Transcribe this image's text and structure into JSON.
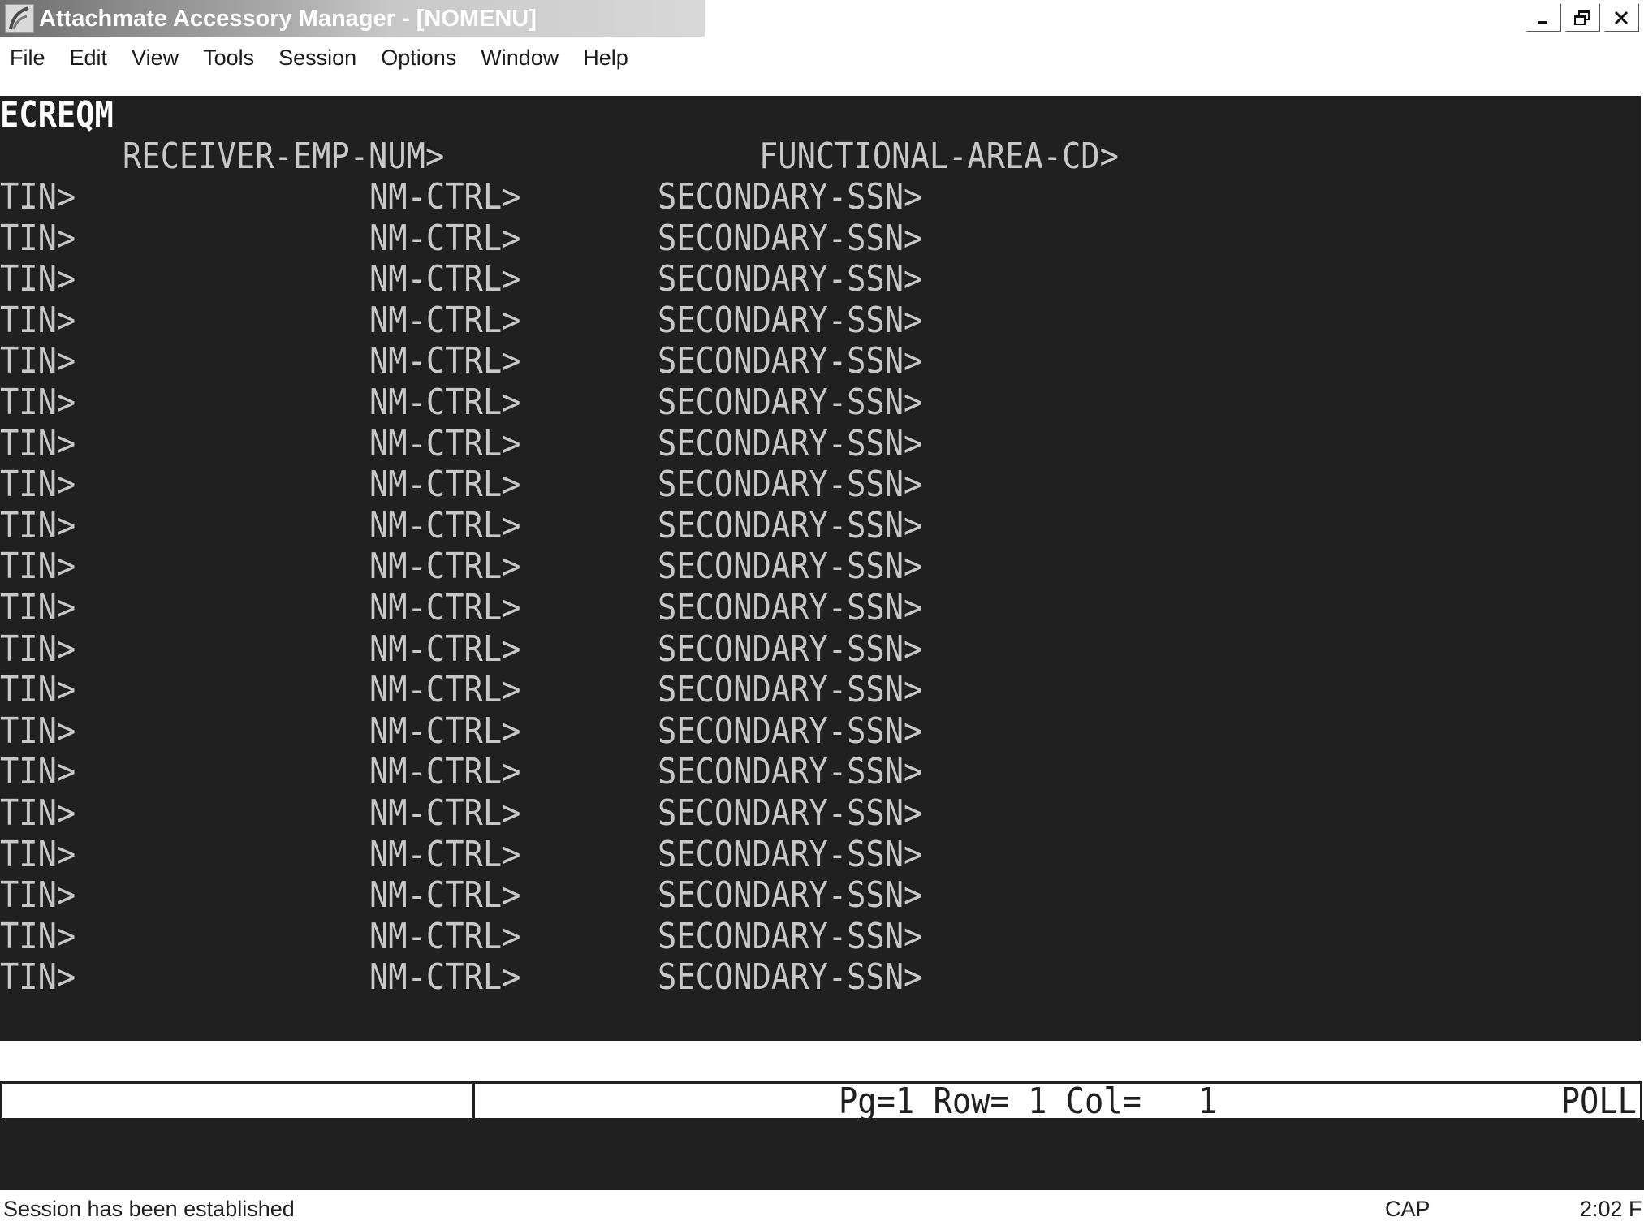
{
  "window": {
    "title": "Attachmate Accessory Manager - [NOMENU]",
    "icon": "attachmate-app-icon",
    "controls": [
      "minimize-icon",
      "restore-icon",
      "close-icon"
    ]
  },
  "menu": {
    "items": [
      "File",
      "Edit",
      "View",
      "Tools",
      "Session",
      "Options",
      "Window",
      "Help"
    ]
  },
  "terminal": {
    "screen_id": "ECREQM",
    "header": {
      "receiver_label": "RECEIVER-EMP-NUM>",
      "functional_label": "FUNCTIONAL-AREA-CD>"
    },
    "rows": [
      {
        "tin": "TIN>",
        "nm": "NM-CTRL>",
        "ssn": "SECONDARY-SSN>"
      },
      {
        "tin": "TIN>",
        "nm": "NM-CTRL>",
        "ssn": "SECONDARY-SSN>"
      },
      {
        "tin": "TIN>",
        "nm": "NM-CTRL>",
        "ssn": "SECONDARY-SSN>"
      },
      {
        "tin": "TIN>",
        "nm": "NM-CTRL>",
        "ssn": "SECONDARY-SSN>"
      },
      {
        "tin": "TIN>",
        "nm": "NM-CTRL>",
        "ssn": "SECONDARY-SSN>"
      },
      {
        "tin": "TIN>",
        "nm": "NM-CTRL>",
        "ssn": "SECONDARY-SSN>"
      },
      {
        "tin": "TIN>",
        "nm": "NM-CTRL>",
        "ssn": "SECONDARY-SSN>"
      },
      {
        "tin": "TIN>",
        "nm": "NM-CTRL>",
        "ssn": "SECONDARY-SSN>"
      },
      {
        "tin": "TIN>",
        "nm": "NM-CTRL>",
        "ssn": "SECONDARY-SSN>"
      },
      {
        "tin": "TIN>",
        "nm": "NM-CTRL>",
        "ssn": "SECONDARY-SSN>"
      },
      {
        "tin": "TIN>",
        "nm": "NM-CTRL>",
        "ssn": "SECONDARY-SSN>"
      },
      {
        "tin": "TIN>",
        "nm": "NM-CTRL>",
        "ssn": "SECONDARY-SSN>"
      },
      {
        "tin": "TIN>",
        "nm": "NM-CTRL>",
        "ssn": "SECONDARY-SSN>"
      },
      {
        "tin": "TIN>",
        "nm": "NM-CTRL>",
        "ssn": "SECONDARY-SSN>"
      },
      {
        "tin": "TIN>",
        "nm": "NM-CTRL>",
        "ssn": "SECONDARY-SSN>"
      },
      {
        "tin": "TIN>",
        "nm": "NM-CTRL>",
        "ssn": "SECONDARY-SSN>"
      },
      {
        "tin": "TIN>",
        "nm": "NM-CTRL>",
        "ssn": "SECONDARY-SSN>"
      },
      {
        "tin": "TIN>",
        "nm": "NM-CTRL>",
        "ssn": "SECONDARY-SSN>"
      },
      {
        "tin": "TIN>",
        "nm": "NM-CTRL>",
        "ssn": "SECONDARY-SSN>"
      },
      {
        "tin": "TIN>",
        "nm": "NM-CTRL>",
        "ssn": "SECONDARY-SSN>"
      }
    ],
    "colors": {
      "background": "#202020",
      "text": "#c8c8c8",
      "screen_id": "#ffffff"
    }
  },
  "oia": {
    "position": "Pg=1 Row= 1 Col=   1",
    "poll": "POLL"
  },
  "statusbar": {
    "message": "Session has been established",
    "cap": "CAP",
    "time": "2:02 F"
  }
}
